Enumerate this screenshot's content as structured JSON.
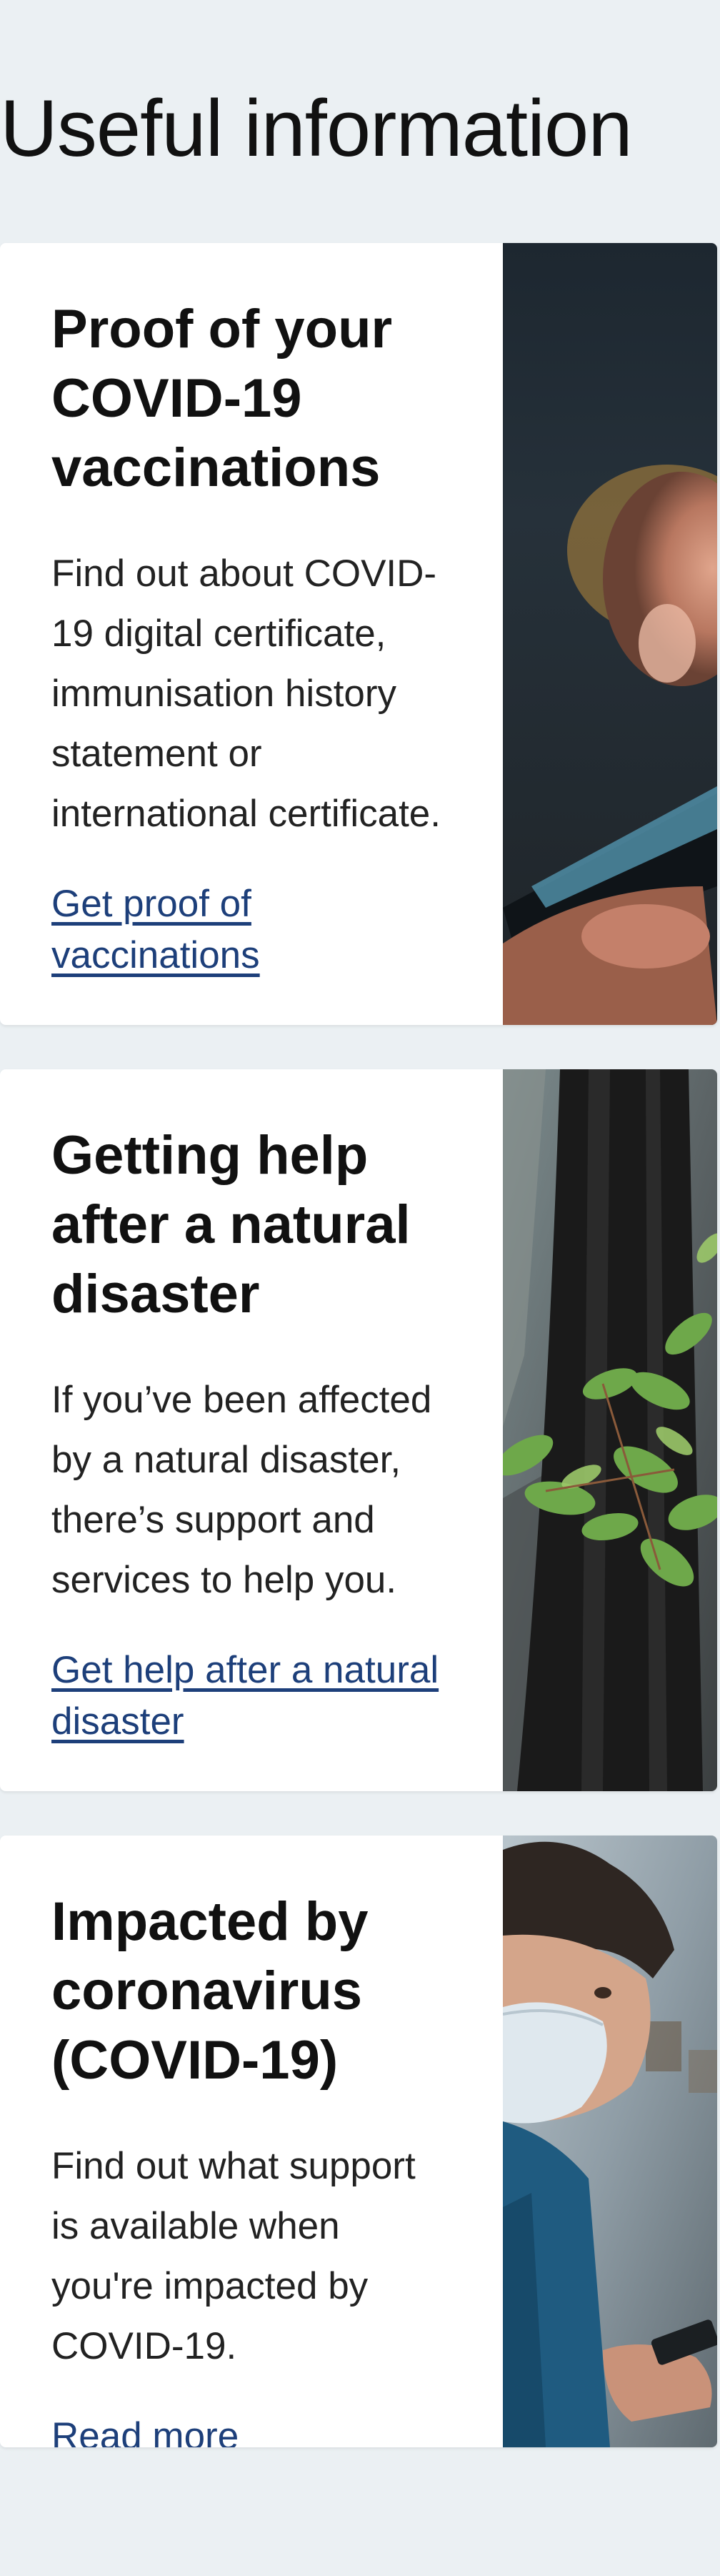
{
  "page": {
    "title": "Useful information"
  },
  "cards": [
    {
      "title": "Proof of your COVID-19 vaccinations",
      "text": "Find out about COVID-19 digital certificate, immunisation history statement or international certificate.",
      "link": "Get proof of vaccinations",
      "image": "phone-in-hand-photo"
    },
    {
      "title": "Getting help after a natural disaster",
      "text": "If you’ve been affected by a natural disaster, there’s support and services to help you.",
      "link": "Get help after a natural disaster",
      "image": "regrowth-on-burnt-tree-photo"
    },
    {
      "title": "Impacted by coronavirus (COVID-19)",
      "text": "Find out what support is available when you're impacted by COVID-19.",
      "link": "Read more",
      "image": "man-in-face-mask-photo"
    }
  ],
  "colors": {
    "background": "#ebf0f3",
    "card": "#ffffff",
    "link": "#1d3f7a",
    "text": "#111111"
  }
}
